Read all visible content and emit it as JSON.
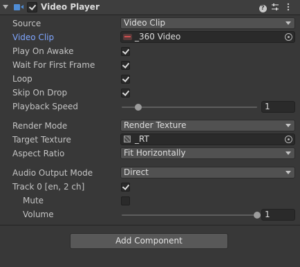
{
  "header": {
    "title": "Video Player",
    "enabled": true,
    "icons": [
      "video-camera-icon",
      "help-icon",
      "presets-icon",
      "menu-kebab-icon"
    ]
  },
  "fields": {
    "source": {
      "label": "Source",
      "value": "Video Clip"
    },
    "video_clip": {
      "label": "Video Clip",
      "value": "_360 Video"
    },
    "play_on_awake": {
      "label": "Play On Awake",
      "checked": true
    },
    "wait_first_frame": {
      "label": "Wait For First Frame",
      "checked": true
    },
    "loop": {
      "label": "Loop",
      "checked": true
    },
    "skip_on_drop": {
      "label": "Skip On Drop",
      "checked": true
    },
    "playback_speed": {
      "label": "Playback Speed",
      "value": "1",
      "slider_fraction": 0.12
    },
    "render_mode": {
      "label": "Render Mode",
      "value": "Render Texture"
    },
    "target_texture": {
      "label": "Target Texture",
      "value": "_RT"
    },
    "aspect_ratio": {
      "label": "Aspect Ratio",
      "value": "Fit Horizontally"
    },
    "audio_output_mode": {
      "label": "Audio Output Mode",
      "value": "Direct"
    },
    "track0": {
      "label": "Track 0 [en, 2 ch]",
      "checked": true
    },
    "mute": {
      "label": "Mute",
      "checked": false
    },
    "volume": {
      "label": "Volume",
      "value": "1",
      "slider_fraction": 1.0
    }
  },
  "add_component_label": "Add Component",
  "colors": {
    "background": "#383838",
    "link_label": "#7fa6ff",
    "header": "#3e3e3e"
  }
}
